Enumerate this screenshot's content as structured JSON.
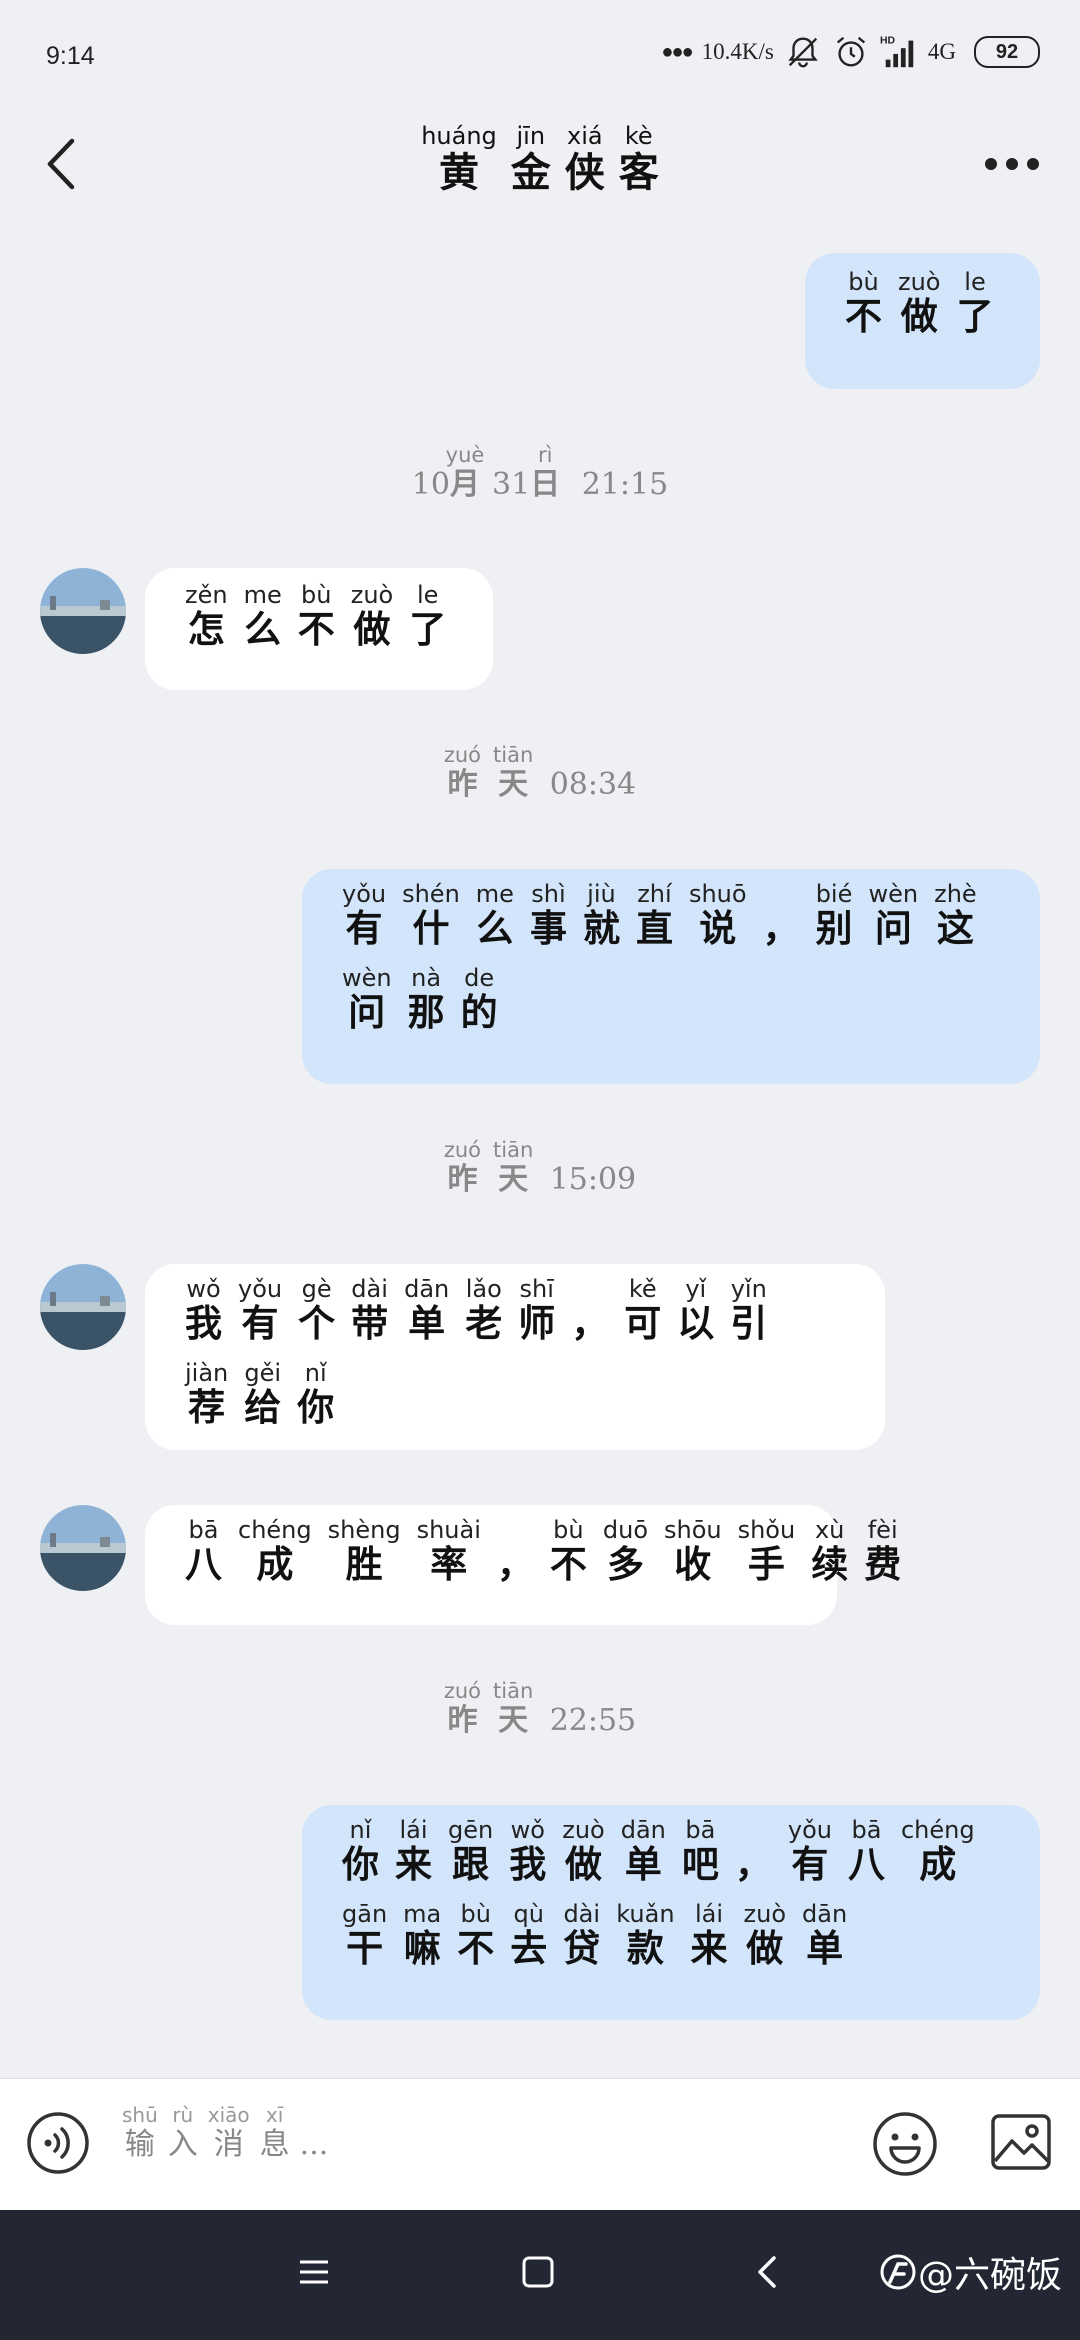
{
  "status_bar": {
    "time": "9:14",
    "net_speed": "10.4K/s",
    "network": "4G",
    "hd": "HD",
    "battery": "92"
  },
  "header": {
    "title": [
      [
        "黄",
        "huáng"
      ],
      [
        "金",
        "jīn"
      ],
      [
        "侠",
        "xiá"
      ],
      [
        "客",
        "kè"
      ]
    ]
  },
  "messages": [
    {
      "side": "me",
      "lines": [
        [
          [
            "不",
            "bù"
          ],
          [
            "做",
            "zuò"
          ],
          [
            "了",
            "le"
          ]
        ]
      ]
    },
    {
      "type": "time",
      "chars": [
        [
          "月",
          "yuè"
        ]
      ],
      "prefix": "10",
      "mid": "31",
      "chars2": [
        [
          "日",
          "rì"
        ]
      ],
      "clock": "21:15"
    },
    {
      "side": "peer",
      "lines": [
        [
          [
            "怎",
            "zěn"
          ],
          [
            "么",
            "me"
          ],
          [
            "不",
            "bù"
          ],
          [
            "做",
            "zuò"
          ],
          [
            "了",
            "le"
          ]
        ]
      ]
    },
    {
      "type": "time",
      "chars": [
        [
          "昨",
          "zuó"
        ],
        [
          "天",
          "tiān"
        ]
      ],
      "clock": "08:34"
    },
    {
      "side": "me",
      "lines": [
        [
          [
            "有",
            "yǒu"
          ],
          [
            "什",
            "shén"
          ],
          [
            "么",
            "me"
          ],
          [
            "事",
            "shì"
          ],
          [
            "就",
            "jiù"
          ],
          [
            "直",
            "zhí"
          ],
          [
            "说",
            "shuō"
          ],
          [
            "，",
            ""
          ],
          [
            "别",
            "bié"
          ],
          [
            "问",
            "wèn"
          ],
          [
            "这",
            "zhè"
          ]
        ],
        [
          [
            "问",
            "wèn"
          ],
          [
            "那",
            "nà"
          ],
          [
            "的",
            "de"
          ]
        ]
      ]
    },
    {
      "type": "time",
      "chars": [
        [
          "昨",
          "zuó"
        ],
        [
          "天",
          "tiān"
        ]
      ],
      "clock": "15:09"
    },
    {
      "side": "peer",
      "lines": [
        [
          [
            "我",
            "wǒ"
          ],
          [
            "有",
            "yǒu"
          ],
          [
            "个",
            "gè"
          ],
          [
            "带",
            "dài"
          ],
          [
            "单",
            "dān"
          ],
          [
            "老",
            "lǎo"
          ],
          [
            "师",
            "shī"
          ],
          [
            "，",
            ""
          ],
          [
            "可",
            "kě"
          ],
          [
            "以",
            "yǐ"
          ],
          [
            "引",
            "yǐn"
          ]
        ],
        [
          [
            "荐",
            "jiàn"
          ],
          [
            "给",
            "gěi"
          ],
          [
            "你",
            "nǐ"
          ]
        ]
      ]
    },
    {
      "side": "peer",
      "lines": [
        [
          [
            "八",
            "bā"
          ],
          [
            "成",
            "chéng"
          ],
          [
            "胜",
            "shèng"
          ],
          [
            "率",
            "shuài"
          ],
          [
            "，",
            ""
          ],
          [
            "不",
            "bù"
          ],
          [
            "多",
            "duō"
          ],
          [
            "收",
            "shōu"
          ],
          [
            "手",
            "shǒu"
          ],
          [
            "续",
            "xù"
          ],
          [
            "费",
            "fèi"
          ]
        ]
      ]
    },
    {
      "type": "time",
      "chars": [
        [
          "昨",
          "zuó"
        ],
        [
          "天",
          "tiān"
        ]
      ],
      "clock": "22:55"
    },
    {
      "side": "me",
      "lines": [
        [
          [
            "你",
            "nǐ"
          ],
          [
            "来",
            "lái"
          ],
          [
            "跟",
            "gēn"
          ],
          [
            "我",
            "wǒ"
          ],
          [
            "做",
            "zuò"
          ],
          [
            "单",
            "dān"
          ],
          [
            "吧",
            "bā"
          ],
          [
            "，",
            ""
          ],
          [
            "有",
            "yǒu"
          ],
          [
            "八",
            "bā"
          ],
          [
            "成",
            "chéng"
          ]
        ],
        [
          [
            "干",
            "gān"
          ],
          [
            "嘛",
            "ma"
          ],
          [
            "不",
            "bù"
          ],
          [
            "去",
            "qù"
          ],
          [
            "贷",
            "dài"
          ],
          [
            "款",
            "kuǎn"
          ],
          [
            "来",
            "lái"
          ],
          [
            "做",
            "zuò"
          ],
          [
            "单",
            "dān"
          ]
        ]
      ]
    }
  ],
  "input": {
    "placeholder": [
      [
        "输",
        "shū"
      ],
      [
        "入",
        "rù"
      ],
      [
        "消",
        "xiāo"
      ],
      [
        "息",
        "xī"
      ]
    ],
    "ellipsis": "..."
  },
  "watermark": "@六碗饭"
}
